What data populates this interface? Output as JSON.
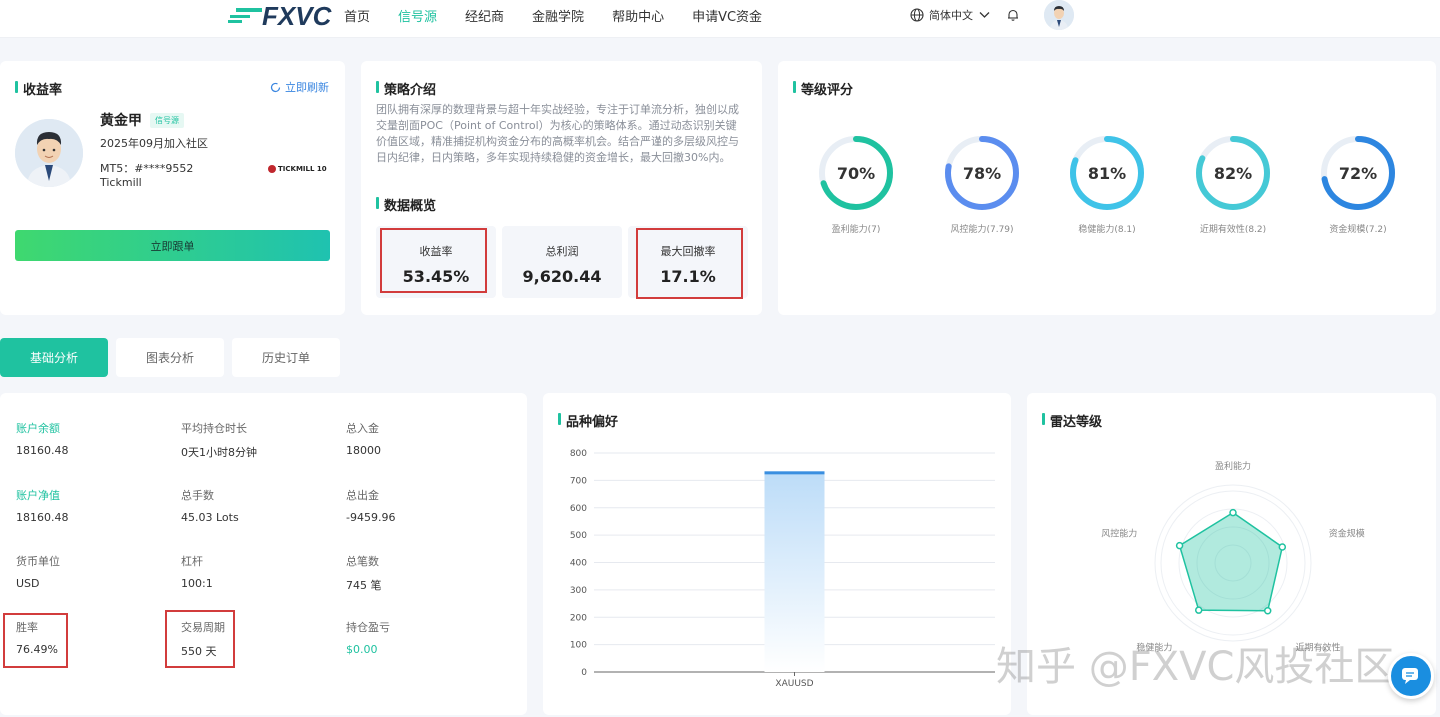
{
  "header": {
    "logo_text": "FXVC",
    "nav": [
      "首页",
      "信号源",
      "经纪商",
      "金融学院",
      "帮助中心",
      "申请VC资金"
    ],
    "active_nav": "信号源",
    "language": "简体中文"
  },
  "profile_card": {
    "title": "收益率",
    "refresh_label": "立即刷新",
    "name": "黄金甲",
    "badge": "信号源",
    "joined": "2025年09月加入社区",
    "mt5": "MT5：#****9552",
    "broker": "Tickmill",
    "broker_logo": "TICKMILL 10",
    "follow_button": "立即跟单"
  },
  "strategy_card": {
    "title": "策略介绍",
    "text": "团队拥有深厚的数理背景与超十年实战经验，专注于订单流分析，独创以成交量剖面POC（Point of Control）为核心的策略体系。通过动态识别关键价值区域，精准捕捉机构资金分布的高概率机会。结合严谨的多层级风控与日内纪律，日内策略，多年实现持续稳健的资金增长，最大回撤30%内。",
    "overview_title": "数据概览",
    "stats": [
      {
        "label": "收益率",
        "value": "53.45%"
      },
      {
        "label": "总利润",
        "value": "9,620.44"
      },
      {
        "label": "最大回撤率",
        "value": "17.1%"
      }
    ]
  },
  "grade_card": {
    "title": "等级评分",
    "rings": [
      {
        "label": "盈利能力(7)",
        "value": "70%",
        "percent": 70,
        "color": "#1fc2a0"
      },
      {
        "label": "风控能力(7.79)",
        "value": "78%",
        "percent": 78,
        "color": "#5b8def"
      },
      {
        "label": "稳健能力(8.1)",
        "value": "81%",
        "percent": 81,
        "color": "#3fc3e8"
      },
      {
        "label": "近期有效性(8.2)",
        "value": "82%",
        "percent": 82,
        "color": "#45c9d6"
      },
      {
        "label": "资金规模(7.2)",
        "value": "72%",
        "percent": 72,
        "color": "#2d86e0"
      }
    ]
  },
  "tabs": [
    "基础分析",
    "图表分析",
    "历史订单"
  ],
  "basic_info": [
    {
      "label": "账户余额",
      "value": "18160.48",
      "highlight": true
    },
    {
      "label": "平均持仓时长",
      "value": "0天1小时8分钟"
    },
    {
      "label": "总入金",
      "value": "18000"
    },
    {
      "label": "账户净值",
      "value": "18160.48",
      "highlight": true
    },
    {
      "label": "总手数",
      "value": "45.03 Lots"
    },
    {
      "label": "总出金",
      "value": "-9459.96"
    },
    {
      "label": "货币单位",
      "value": "USD"
    },
    {
      "label": "杠杆",
      "value": "100:1"
    },
    {
      "label": "总笔数",
      "value": "745 笔"
    },
    {
      "label": "胜率",
      "value": "76.49%"
    },
    {
      "label": "交易周期",
      "value": "550 天"
    },
    {
      "label": "持仓盈亏",
      "value": "$0.00",
      "value_green": true
    }
  ],
  "variety_card": {
    "title": "品种偏好"
  },
  "chart_data": {
    "type": "bar",
    "categories": [
      "XAUUSD"
    ],
    "values": [
      733
    ],
    "ylim": [
      0,
      800
    ],
    "yticks": [
      0,
      100,
      200,
      300,
      400,
      500,
      600,
      700,
      800
    ],
    "grid": true,
    "bar_color": "#3a8fe0"
  },
  "radar_card": {
    "title": "雷达等级",
    "axes": [
      "盈利能力",
      "资金规模",
      "近期有效性",
      "稳健能力",
      "风控能力"
    ],
    "values": [
      70,
      72,
      82,
      81,
      78
    ]
  },
  "watermark": "知乎 @FXVC风投社区"
}
